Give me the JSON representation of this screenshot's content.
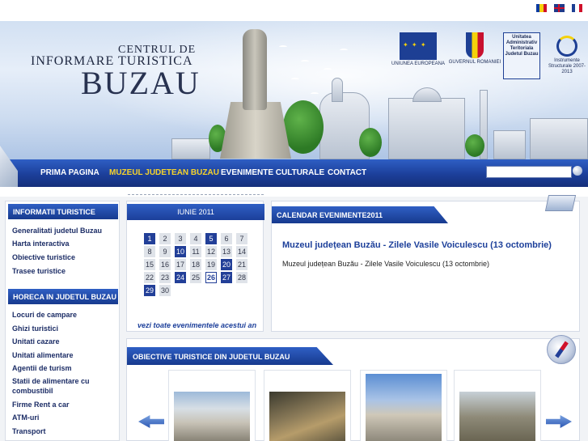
{
  "languages": [
    {
      "code": "ro",
      "colors": [
        "#0b3ba0",
        "#f4d10b",
        "#d0102a"
      ]
    },
    {
      "code": "en"
    },
    {
      "code": "fr",
      "colors": [
        "#1d3f94",
        "#ffffff",
        "#d0102a"
      ]
    }
  ],
  "logo": {
    "line1": "CENTRUL DE",
    "line2": "INFORMARE TURISTICA",
    "line3": "BUZAU"
  },
  "partners": {
    "eu": "UNIUNEA EUROPEANA",
    "gov": "GUVERNUL ROMANIEI",
    "uat": "Unitatea Administrativ Teritoriala Judetul Buzau",
    "is": "Instrumente Structurale 2007-2013"
  },
  "nav": {
    "home": "PRIMA PAGINA",
    "museum": "MUZEUL JUDETEAN BUZAU",
    "events": "EVENIMENTE CULTURALE",
    "contact": "CONTACT",
    "search_value": ""
  },
  "sidebar": {
    "info_heading": "INFORMATII TURISTICE",
    "info_items": [
      "Generalitati judetul Buzau",
      "Harta interactiva",
      "Obiective turistice",
      "Trasee turistice"
    ],
    "horeca_heading": "HORECA IN JUDETUL BUZAU",
    "horeca_items": [
      "Locuri de campare",
      "Ghizi turistici",
      "Unitati cazare",
      "Unitati alimentare",
      "Agentii de turism",
      "Statii de alimentare cu",
      "combustibil",
      "Firme Rent a car",
      "ATM-uri",
      "Transport"
    ]
  },
  "calendar": {
    "month": "IUNIE 2011",
    "days": [
      1,
      2,
      3,
      4,
      5,
      6,
      7,
      8,
      9,
      10,
      11,
      12,
      13,
      14,
      15,
      16,
      17,
      18,
      19,
      20,
      21,
      22,
      23,
      24,
      25,
      26,
      27,
      28,
      29,
      30
    ],
    "start_col": 0,
    "event_days": [
      1,
      5,
      10,
      20,
      24,
      27,
      29
    ],
    "today": 26,
    "link": "vezi toate evenimentele acestui an"
  },
  "events": {
    "heading": "CALENDAR EVENIMENTE2011",
    "title": "Muzeul județean Buzău - Zilele Vasile Voiculescu (13 octombrie)",
    "description": "Muzeul județean Buzău - Zilele Vasile Voiculescu (13 octombrie)"
  },
  "objectives": {
    "heading": "OBIECTIVE TURISTICE DIN JUDETUL BUZAU",
    "cards": [
      "card-1",
      "card-2",
      "card-3",
      "card-4"
    ]
  }
}
